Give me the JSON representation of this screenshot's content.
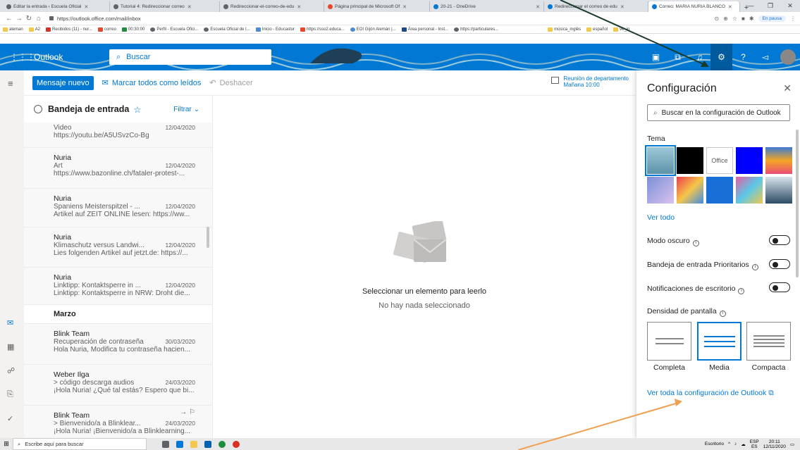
{
  "browser": {
    "tabs": [
      {
        "label": "Editar la entrada ‹ Escuela Oficial"
      },
      {
        "label": "Tutorial 4: Redireccionar correo"
      },
      {
        "label": "Redireccionar-el-correo-de-edu"
      },
      {
        "label": "Página principal de Microsoft Of"
      },
      {
        "label": "20-21 - OneDrive"
      },
      {
        "label": "Redireccionar el correo de edu"
      },
      {
        "label": "Correo: MARIA NURIA BLANCO"
      }
    ],
    "url": "https://outlook.office.com/mail/inbox",
    "pause_label": "En pausa",
    "bookmarks": [
      "aleman",
      "A2",
      "Recibidos (11) - nur...",
      "correo",
      "00:30:00",
      "Perfil - Escuela Ofici...",
      "Escuela Oficial de I...",
      "Inicio - Educastur",
      "https://sso2.educa...",
      "EOI Gijón Alemán |...",
      "Área personal - Inst...",
      "https://particulares...",
      "música_inglés",
      "español",
      "ve_in"
    ]
  },
  "header": {
    "brand": "Outlook",
    "search_placeholder": "Buscar"
  },
  "commands": {
    "new_message": "Mensaje nuevo",
    "mark_all_read": "Marcar todos como leídos",
    "undo": "Deshacer",
    "meeting_title": "Reunión de departamento",
    "meeting_time": "Mañana 10:00"
  },
  "folder": {
    "name": "Bandeja de entrada",
    "filter": "Filtrar"
  },
  "messages_top": [
    {
      "sender": "",
      "subject": "Video",
      "date": "12/04/2020",
      "preview": "https://youtu.be/A5USvzCo-Bg"
    },
    {
      "sender": "Nuria",
      "subject": "Art",
      "date": "12/04/2020",
      "preview": "https://www.bazonline.ch/fataler-protest-..."
    },
    {
      "sender": "Nuria",
      "subject": "Spaniens Meisterspitzel - ...",
      "date": "12/04/2020",
      "preview": "Artikel auf ZEIT ONLINE lesen: https://ww..."
    },
    {
      "sender": "Nuria",
      "subject": "Klimaschutz versus Landwi...",
      "date": "12/04/2020",
      "preview": "Lies folgenden Artikel auf jetzt.de: https://..."
    },
    {
      "sender": "Nuria",
      "subject": "Linktipp: Kontaktsperre in ...",
      "date": "12/04/2020",
      "preview": "Linktipp: Kontaktsperre in NRW: Droht die..."
    }
  ],
  "section_march": "Marzo",
  "messages_march": [
    {
      "sender": "Blink Team",
      "subject": "Recuperación de contraseña",
      "date": "30/03/2020",
      "preview": "Hola Nuria, Modifica tu contraseña hacien..."
    },
    {
      "sender": "Weber Ilga",
      "subject": "> código descarga audios",
      "date": "24/03/2020",
      "preview": "¡Hola Nuria! ¿Qué tal estás? Espero que bi..."
    },
    {
      "sender": "Blink Team",
      "subject": "> Bienvenido/a a Blinklear...",
      "date": "24/03/2020",
      "preview": "¡Hola Nuria! ¡Bienvenido/a a Blinklearning..."
    }
  ],
  "reading": {
    "title": "Seleccionar un elemento para leerlo",
    "subtitle": "No hay nada seleccionado"
  },
  "settings": {
    "title": "Configuración",
    "search_placeholder": "Buscar en la configuración de Outlook",
    "theme_label": "Tema",
    "office_theme": "Office",
    "see_all": "Ver todo",
    "dark_mode": "Modo oscuro",
    "focused_inbox": "Bandeja de entrada Prioritarios",
    "desktop_notifications": "Notificaciones de escritorio",
    "density_label": "Densidad de pantalla",
    "density_options": [
      "Completa",
      "Media",
      "Compacta"
    ],
    "view_all_settings": "Ver toda la configuración de Outlook"
  },
  "taskbar": {
    "search_placeholder": "Escribe aquí para buscar",
    "desktop": "Escritorio",
    "lang": "ESP",
    "lang_sub": "ES",
    "time": "20:11",
    "date": "12/11/2020"
  },
  "colors": {
    "accent": "#0078d4",
    "annotation_arrow_top": "#1b3a2a",
    "annotation_arrow_bottom": "#f0a050"
  }
}
